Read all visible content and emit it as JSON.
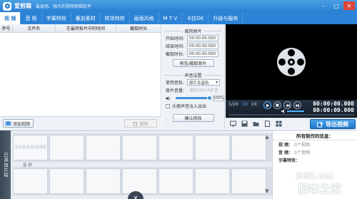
{
  "window": {
    "title": "爱剪辑",
    "subtitle": "最易用、强大的视频剪辑软件",
    "controls": [
      "minimize",
      "maximize",
      "close"
    ]
  },
  "menu": {
    "tabs": [
      {
        "label": "视 频",
        "active": true
      },
      {
        "label": "音 频",
        "active": false
      },
      {
        "label": "字幕特效",
        "active": false
      },
      {
        "label": "叠加素材",
        "active": false
      },
      {
        "label": "转场特效",
        "active": false
      },
      {
        "label": "画面风格",
        "active": false
      },
      {
        "label": "M T V",
        "active": false
      },
      {
        "label": "卡拉OK",
        "active": false
      },
      {
        "label": "升级与服务",
        "active": false
      }
    ]
  },
  "video_list": {
    "columns": [
      "序号",
      "文件名",
      "在最终影片中的时间",
      "截取时长"
    ],
    "add_button": "添加视频",
    "delete_button": "删除"
  },
  "clip_settings": {
    "section_title": "裁剪原片",
    "start_label": "开始时间:",
    "start_value": "00:00:00.000",
    "end_label": "结束时间:",
    "end_value": "00:00:00.000",
    "duration_label": "截取时长:",
    "duration_value": "00:00:00.000",
    "preview_button": "预览/截取原片",
    "audio_section_title": "声音设置",
    "track_label": "使用音轨:",
    "track_value": "原片无音轨",
    "volume_label": "原片音量:",
    "volume_hint": "超过100%为扩音",
    "volume_value": "100%",
    "volume_level": 1.0,
    "fade_label": "头尾声音淡入淡出",
    "fade_checked": false,
    "confirm_button": "确认修改"
  },
  "player": {
    "speed_options": [
      "1/2X",
      "1X",
      "2X"
    ],
    "speed_selected": "1X",
    "timecode_current": "00:00:00.000",
    "timecode_total": "00:00:00.000",
    "progress": 0,
    "volume_level": 0.6,
    "export_button": "导出视频"
  },
  "timeline": {
    "side_tab": "已添加片段",
    "placeholder": "双击此处添加视频",
    "audio_label": "音 频"
  },
  "info_panel": {
    "title": "所有制作的信息：",
    "rows": [
      {
        "key": "视 频：",
        "value": "0个视频"
      },
      {
        "key": "音 频：",
        "value": "0个音频"
      },
      {
        "key": "字幕特效：",
        "value": ""
      }
    ]
  },
  "watermark": {
    "line1": "jb51.net",
    "line2": "脚本之家"
  },
  "colors": {
    "accent": "#2a7fd2",
    "player_bg": "#000000",
    "export": "#1f74c8"
  }
}
